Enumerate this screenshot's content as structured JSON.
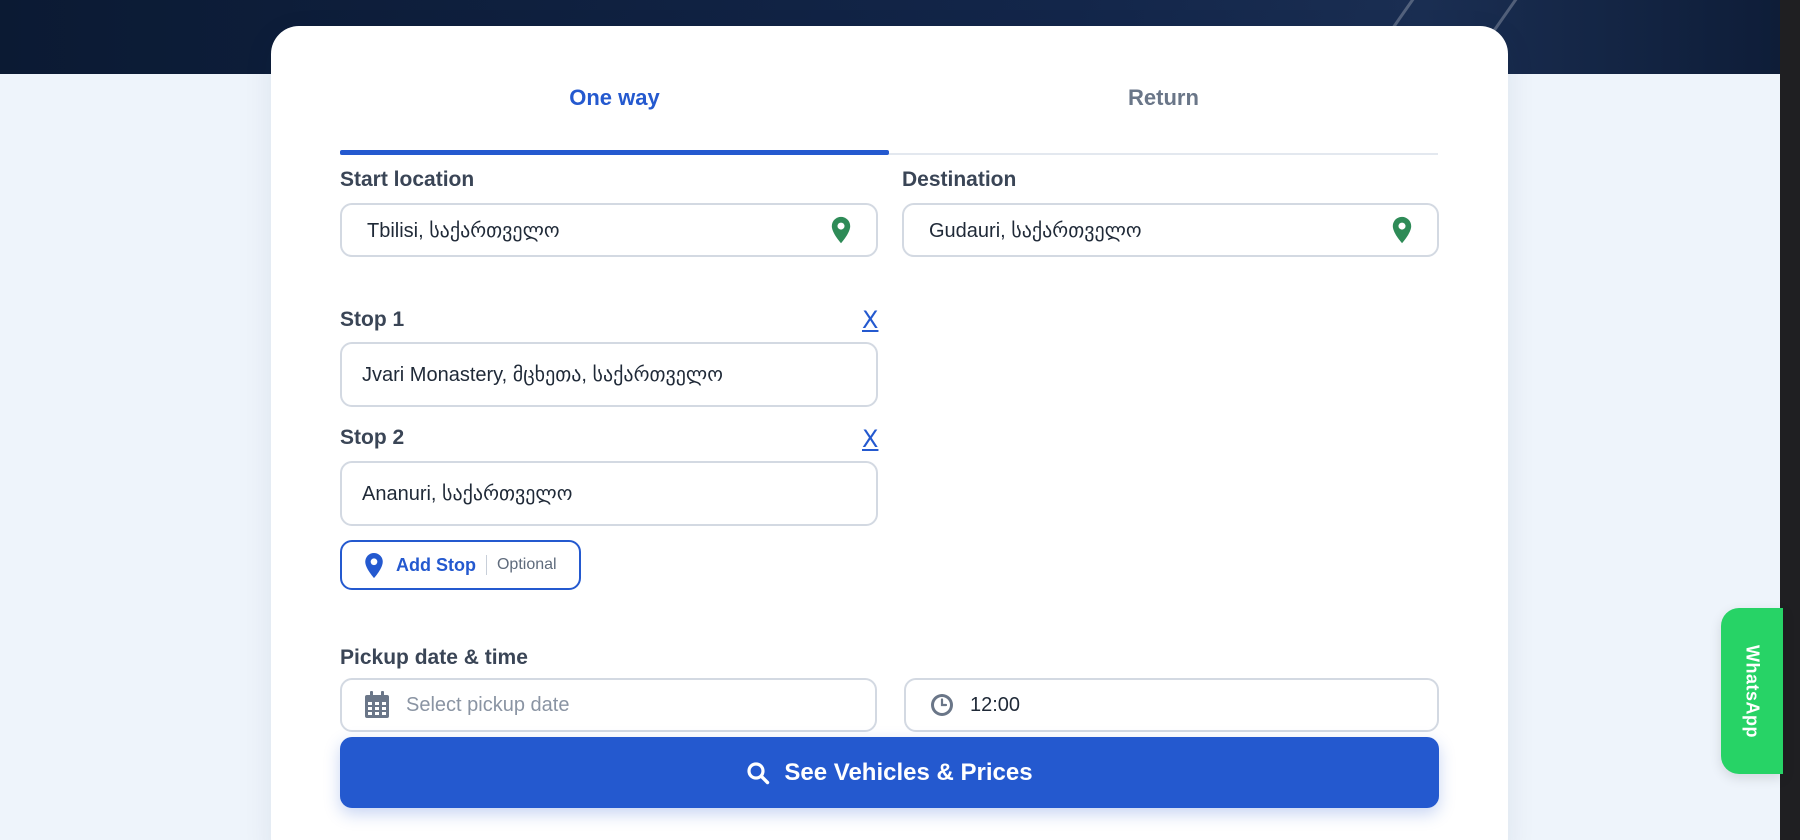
{
  "tabs": [
    {
      "label": "One way",
      "active": true
    },
    {
      "label": "Return",
      "active": false
    }
  ],
  "start": {
    "label": "Start location",
    "value": "Tbilisi, საქართველო"
  },
  "destination": {
    "label": "Destination",
    "value": "Gudauri, საქართველო"
  },
  "stops": [
    {
      "label": "Stop 1",
      "value": "Jvari Monastery, მცხეთა, საქართველო",
      "remove": "X"
    },
    {
      "label": "Stop 2",
      "value": "Ananuri, საქართველო",
      "remove": "X"
    }
  ],
  "add_stop": {
    "label": "Add Stop",
    "optional": "Optional"
  },
  "pickup": {
    "label": "Pickup date & time",
    "date_placeholder": "Select pickup date",
    "time_value": "12:00"
  },
  "cta": {
    "label": "See Vehicles & Prices"
  },
  "whatsapp": {
    "label": "WhatsApp"
  },
  "colors": {
    "accent": "#2459cf",
    "pin": "#2e8b57",
    "whatsapp": "#27d366",
    "hero": "#0b1a33"
  }
}
